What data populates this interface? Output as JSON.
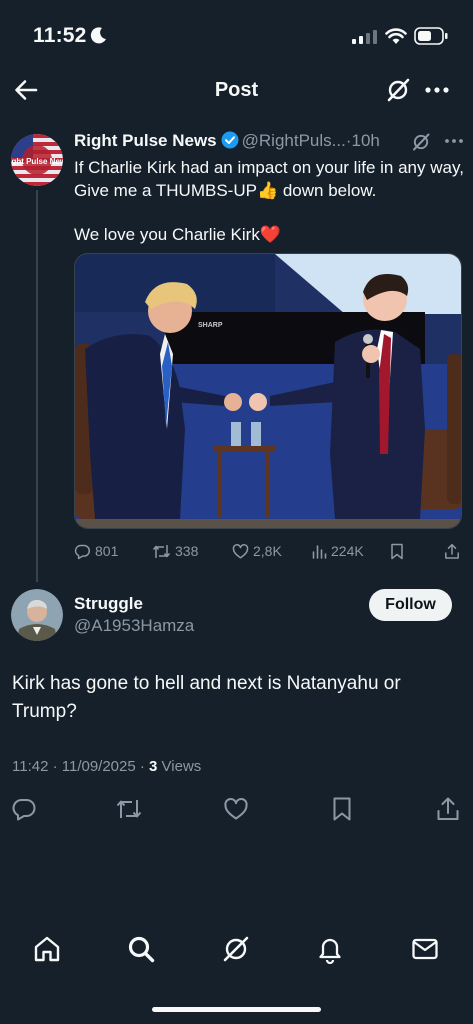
{
  "status_bar": {
    "time": "11:52"
  },
  "header": {
    "title": "Post"
  },
  "parent_post": {
    "author_name": "Right Pulse News",
    "author_handle": "@RightPuls...",
    "time_ago": "10h",
    "dot": "·",
    "text_line1": "If Charlie Kirk had an impact on your life in any way, Give me a THUMBS-UP👍 down below.",
    "text_line2": "We love you Charlie Kirk❤️",
    "avatar_text": "Right Pulse News",
    "media_sign": "SHARP",
    "stats": {
      "replies": "801",
      "reposts": "338",
      "likes": "2,8K",
      "views": "224K"
    }
  },
  "main_post": {
    "author_name": "Struggle",
    "author_handle": "@A1953Hamza",
    "follow_label": "Follow",
    "text": "Kirk has gone to hell and next is Natanyahu or Trump?",
    "timestamp": "11:42 · 11/09/2025 · ",
    "views_count": "3",
    "views_label": " Views"
  },
  "icons": [
    "moon-icon",
    "signal-icon",
    "wifi-icon",
    "battery-icon",
    "back-arrow-icon",
    "grok-icon",
    "more-icon",
    "verified-badge-icon",
    "reply-icon",
    "repost-icon",
    "like-icon",
    "views-icon",
    "bookmark-icon",
    "share-icon",
    "home-icon",
    "search-icon",
    "notifications-icon",
    "messages-icon"
  ],
  "colors": {
    "background": "#15202b",
    "text": "#f7f9f9",
    "secondary": "#8b98a5",
    "verified": "#1d9bf0",
    "divider": "#38444d"
  }
}
